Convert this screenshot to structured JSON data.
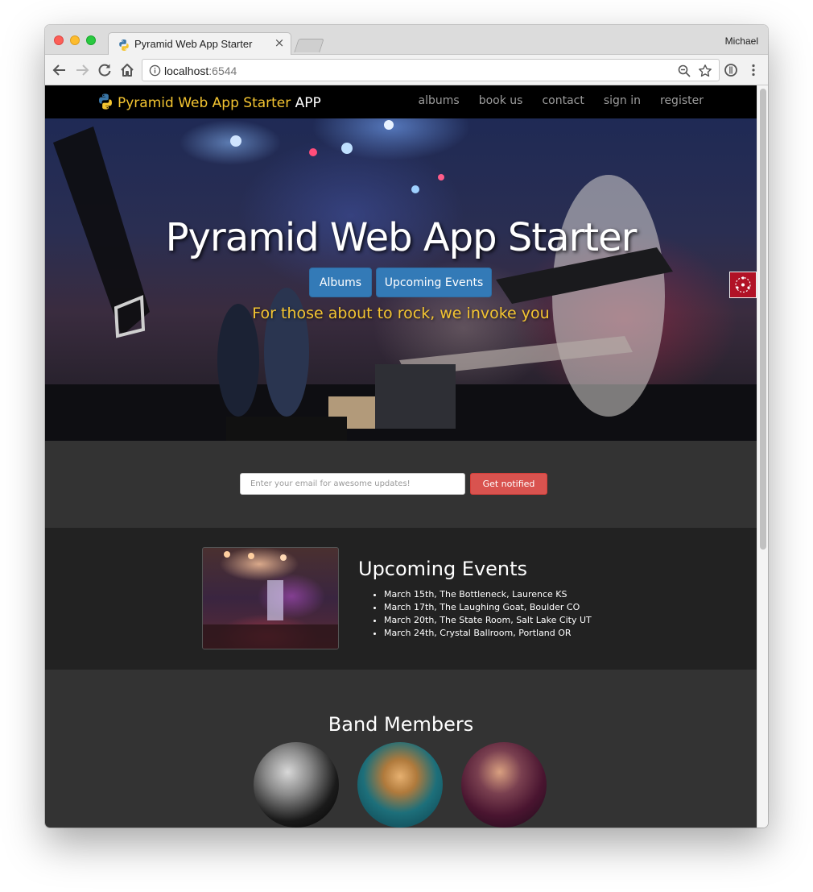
{
  "browser": {
    "tab_title": "Pyramid Web App Starter",
    "tab_close": "×",
    "profile_name": "Michael",
    "url_host": "localhost",
    "url_port": ":6544"
  },
  "navbar": {
    "brand_name": "Pyramid Web App Starter",
    "brand_suffix": "APP",
    "links": [
      "albums",
      "book us",
      "contact",
      "sign in",
      "register"
    ]
  },
  "hero": {
    "title": "Pyramid Web App Starter",
    "buttons": [
      "Albums",
      "Upcoming Events"
    ],
    "subtitle": "For those about to rock, we invoke you"
  },
  "notify": {
    "email_placeholder": "Enter your email for awesome updates!",
    "button_label": "Get notified"
  },
  "events": {
    "title": "Upcoming Events",
    "items": [
      "March 15th, The Bottleneck, Laurence KS",
      "March 17th, The Laughing Goat, Boulder CO",
      "March 20th, The State Room, Salt Lake City UT",
      "March 24th, Crystal Ballroom, Portland OR"
    ]
  },
  "band": {
    "title": "Band Members"
  },
  "colors": {
    "brand_yellow": "#f4c531",
    "primary_button": "#337ab7",
    "danger_button": "#d9534f",
    "navbar_bg": "#000000",
    "section_dark": "#222222",
    "section_mid": "#333333"
  }
}
